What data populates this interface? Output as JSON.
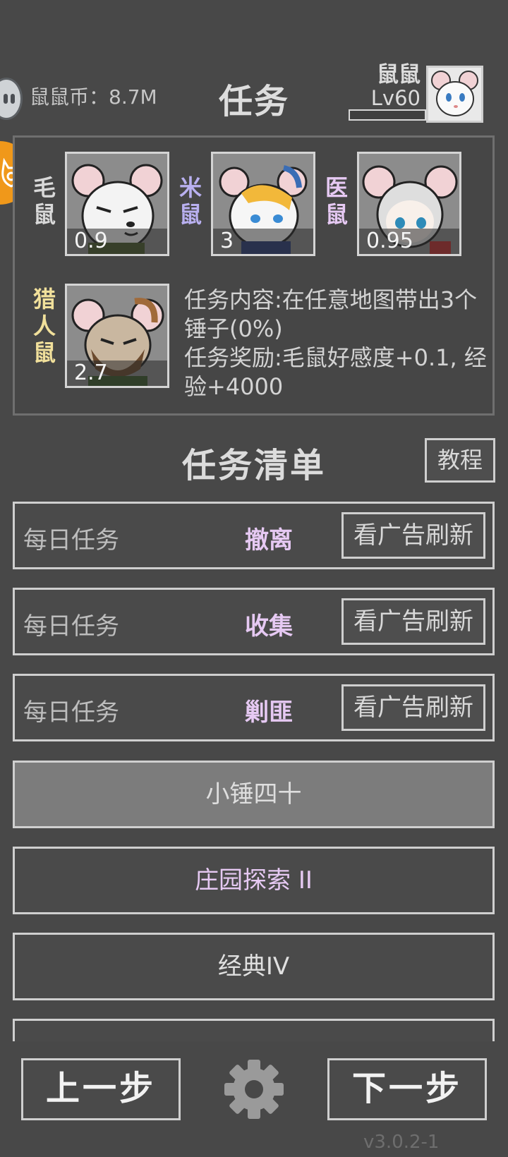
{
  "header": {
    "coin_label": "鼠鼠币：8.7M",
    "coin_icon": "mouse-coin-icon",
    "title": "任务",
    "player_name": "鼠鼠",
    "player_level": "Lv60"
  },
  "mission": {
    "npcs": [
      {
        "label": "毛鼠",
        "value": "0.9",
        "color": "#d9d9d9"
      },
      {
        "label": "米鼠",
        "value": "3",
        "color": "#b9b0f0"
      },
      {
        "label": "医鼠",
        "value": "0.95",
        "color": "#e6c9f3"
      }
    ],
    "hunter": {
      "label": "猎人鼠",
      "value": "2.7",
      "color": "#f1e09b"
    },
    "content": "任务内容:在任意地图带出3个锤子(0%)",
    "reward": "任务奖励:毛鼠好感度+0.1, 经验+4000"
  },
  "task_list": {
    "title": "任务清单",
    "tutorial_label": "教程",
    "daily": [
      {
        "kind": "每日任务",
        "name": "撤离",
        "refresh": "看广告刷新"
      },
      {
        "kind": "每日任务",
        "name": "收集",
        "refresh": "看广告刷新"
      },
      {
        "kind": "每日任务",
        "name": "剿匪",
        "refresh": "看广告刷新"
      }
    ],
    "others": [
      {
        "name": "小锤四十"
      },
      {
        "name": "庄园探索 II"
      },
      {
        "name": "经典IV"
      }
    ]
  },
  "footer": {
    "prev_label": "上一步",
    "next_label": "下一步",
    "version": "v3.0.2-1"
  },
  "colors": {
    "background": "#484848",
    "accent_purple": "#e6c9f3",
    "accent_blue": "#b9b0f0",
    "accent_yellow": "#f1e09b",
    "badge_orange": "#f0981a"
  }
}
